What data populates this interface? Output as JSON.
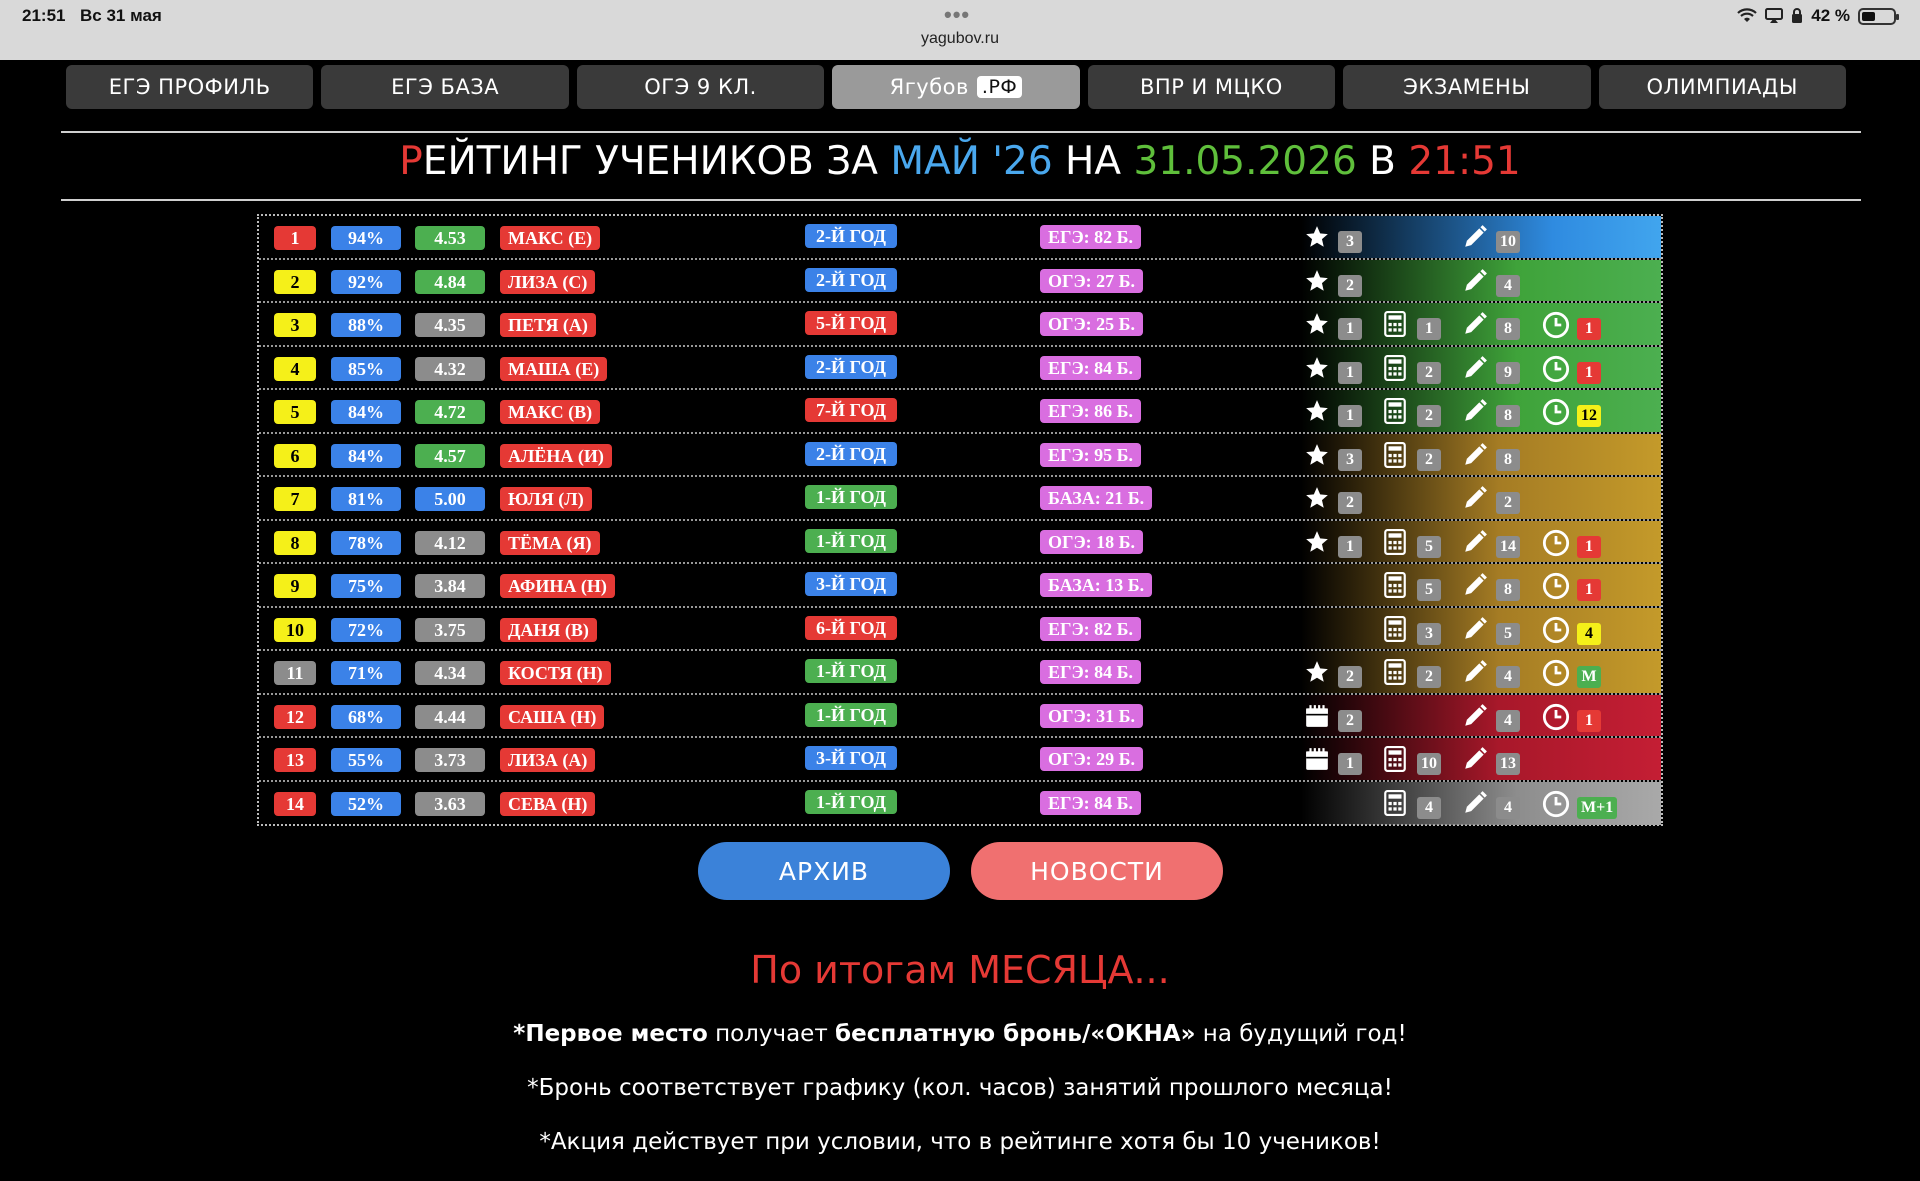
{
  "status_bar": {
    "time": "21:51",
    "date": "Вс 31 мая",
    "dots": "•••",
    "url": "yagubov.ru",
    "battery": "42 %",
    "battery_level": 0.42
  },
  "nav": {
    "tabs": [
      {
        "label": "ЕГЭ ПРОФИЛЬ"
      },
      {
        "label": "ЕГЭ БАЗА"
      },
      {
        "label": "ОГЭ 9 КЛ."
      },
      {
        "label": "Ягубов",
        "badge": ".РФ",
        "active": true
      },
      {
        "label": "ВПР И МЦКО"
      },
      {
        "label": "ЭКЗАМЕНЫ"
      },
      {
        "label": "ОЛИМПИАДЫ"
      }
    ]
  },
  "title": {
    "first_letter": "Р",
    "part1": "ЕЙТИНГ УЧЕНИКОВ ЗА ",
    "month": "МАЙ '26",
    "part2": " НА ",
    "date": "31.05.2026",
    "part3": " В ",
    "time": "21:51"
  },
  "colors": {
    "red": "#e53935",
    "blue": "#3b82e8",
    "green": "#4caf50",
    "gray": "#8c8c8c",
    "yellow": "#f5f019",
    "pink": "#d96ee0",
    "gold": "#c49a2a"
  },
  "icons": {
    "star": "star-icon",
    "calc": "calculator-icon",
    "pen": "pencil-icon",
    "clock": "clock-icon",
    "calendar": "calendar-icon"
  },
  "rating": [
    {
      "rank": "1",
      "rank_color": "red",
      "pct": "94%",
      "avg": "4.53",
      "avg_color": "green",
      "name": "МАКС (Е)",
      "year": "2-Й ГОД",
      "year_color": "blue",
      "exam": "ЕГЭ: 82 Б.",
      "star": "3",
      "pen": "10",
      "bg": "blue"
    },
    {
      "rank": "2",
      "rank_color": "yellow",
      "pct": "92%",
      "avg": "4.84",
      "avg_color": "green",
      "name": "ЛИЗА (С)",
      "year": "2-Й ГОД",
      "year_color": "blue",
      "exam": "ОГЭ: 27 Б.",
      "star": "2",
      "pen": "4",
      "bg": "green"
    },
    {
      "rank": "3",
      "rank_color": "yellow",
      "pct": "88%",
      "avg": "4.35",
      "avg_color": "gray",
      "name": "ПЕТЯ (А)",
      "year": "5-Й ГОД",
      "year_color": "red",
      "exam": "ОГЭ: 25 Б.",
      "star": "1",
      "calc": "1",
      "pen": "8",
      "clock": "1",
      "clock_color": "red",
      "bg": "green"
    },
    {
      "rank": "4",
      "rank_color": "yellow",
      "pct": "85%",
      "avg": "4.32",
      "avg_color": "gray",
      "name": "МАША (Е)",
      "year": "2-Й ГОД",
      "year_color": "blue",
      "exam": "ЕГЭ: 84 Б.",
      "star": "1",
      "calc": "2",
      "pen": "9",
      "clock": "1",
      "clock_color": "red",
      "bg": "green"
    },
    {
      "rank": "5",
      "rank_color": "yellow",
      "pct": "84%",
      "avg": "4.72",
      "avg_color": "green",
      "name": "МАКС (В)",
      "year": "7-Й ГОД",
      "year_color": "red",
      "exam": "ЕГЭ: 86 Б.",
      "star": "1",
      "calc": "2",
      "pen": "8",
      "clock": "12",
      "clock_color": "yellow",
      "bg": "green"
    },
    {
      "rank": "6",
      "rank_color": "yellow",
      "pct": "84%",
      "avg": "4.57",
      "avg_color": "green",
      "name": "АЛЁНА (И)",
      "year": "2-Й ГОД",
      "year_color": "blue",
      "exam": "ЕГЭ: 95 Б.",
      "star": "3",
      "calc": "2",
      "pen": "8",
      "bg": "gold"
    },
    {
      "rank": "7",
      "rank_color": "yellow",
      "pct": "81%",
      "avg": "5.00",
      "avg_color": "blue",
      "name": "ЮЛЯ (Л)",
      "year": "1-Й ГОД",
      "year_color": "green",
      "exam": "БАЗА: 21 Б.",
      "star": "2",
      "pen": "2",
      "bg": "gold"
    },
    {
      "rank": "8",
      "rank_color": "yellow",
      "pct": "78%",
      "avg": "4.12",
      "avg_color": "gray",
      "name": "ТЁМА (Я)",
      "year": "1-Й ГОД",
      "year_color": "green",
      "exam": "ОГЭ: 18 Б.",
      "star": "1",
      "calc": "5",
      "pen": "14",
      "clock": "1",
      "clock_color": "red",
      "bg": "gold"
    },
    {
      "rank": "9",
      "rank_color": "yellow",
      "pct": "75%",
      "avg": "3.84",
      "avg_color": "gray",
      "name": "АФИНА (Н)",
      "year": "3-Й ГОД",
      "year_color": "blue",
      "exam": "БАЗА: 13 Б.",
      "calc": "5",
      "pen": "8",
      "clock": "1",
      "clock_color": "red",
      "bg": "gold"
    },
    {
      "rank": "10",
      "rank_color": "yellow",
      "pct": "72%",
      "avg": "3.75",
      "avg_color": "gray",
      "name": "ДАНЯ (В)",
      "year": "6-Й ГОД",
      "year_color": "red",
      "exam": "ЕГЭ: 82 Б.",
      "calc": "3",
      "pen": "5",
      "clock": "4",
      "clock_color": "yellow",
      "bg": "gold"
    },
    {
      "rank": "11",
      "rank_color": "gray",
      "pct": "71%",
      "avg": "4.34",
      "avg_color": "gray",
      "name": "КОСТЯ (Н)",
      "year": "1-Й ГОД",
      "year_color": "green",
      "exam": "ЕГЭ: 84 Б.",
      "star": "2",
      "calc": "2",
      "pen": "4",
      "clock": "М",
      "clock_color": "green",
      "bg": "gold"
    },
    {
      "rank": "12",
      "rank_color": "red",
      "pct": "68%",
      "avg": "4.44",
      "avg_color": "gray",
      "name": "САША (Н)",
      "year": "1-Й ГОД",
      "year_color": "green",
      "exam": "ОГЭ: 31 Б.",
      "cal": "2",
      "pen": "4",
      "clock": "1",
      "clock_color": "red",
      "bg": "crimson"
    },
    {
      "rank": "13",
      "rank_color": "red",
      "pct": "55%",
      "avg": "3.73",
      "avg_color": "gray",
      "name": "ЛИЗА (А)",
      "year": "3-Й ГОД",
      "year_color": "blue",
      "exam": "ОГЭ: 29 Б.",
      "cal": "1",
      "calc": "10",
      "pen": "13",
      "bg": "crimson"
    },
    {
      "rank": "14",
      "rank_color": "red",
      "pct": "52%",
      "avg": "3.63",
      "avg_color": "gray",
      "name": "СЕВА (Н)",
      "year": "1-Й ГОД",
      "year_color": "green",
      "exam": "ЕГЭ: 84 Б.",
      "calc": "4",
      "pen": "4",
      "clock": "М+1",
      "clock_color": "green",
      "bg": "silver"
    }
  ],
  "buttons": {
    "archive": "АРХИВ",
    "news": "НОВОСТИ"
  },
  "footer": {
    "title": "По итогам МЕСЯЦА...",
    "note1_bold1": "*Первое место",
    "note1_mid": " получает ",
    "note1_bold2": "бесплатную бронь/«ОКНА»",
    "note1_end": " на будущий год!",
    "note2": "*Бронь соответствует графику (кол. часов) занятий прошлого месяца!",
    "note3": "*Акция действует при условии, что в рейтинге хотя бы 10 учеников!"
  }
}
